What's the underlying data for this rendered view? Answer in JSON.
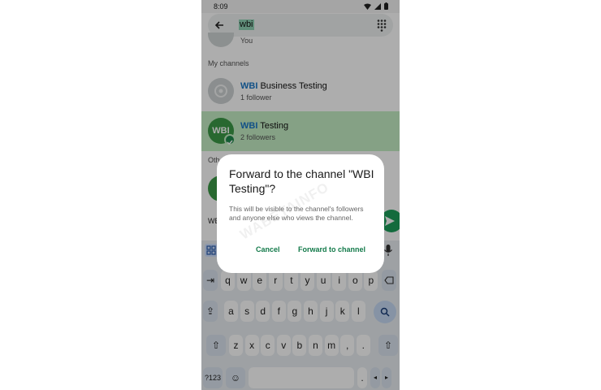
{
  "status_bar": {
    "time": "8:09"
  },
  "search": {
    "query": "wbi"
  },
  "partial_row": {
    "subtitle": "You"
  },
  "sections": {
    "my_channels": "My channels",
    "other": "Oth"
  },
  "channels": [
    {
      "highlight": "WBI",
      "name": " Business Testing",
      "subtitle": "1 follower"
    },
    {
      "highlight": "WBI",
      "name": " Testing",
      "subtitle": "2 followers",
      "avatar_text": "WBI"
    }
  ],
  "compose": {
    "text": "WB"
  },
  "keyboard": {
    "rows": [
      [
        "q",
        "w",
        "e",
        "r",
        "t",
        "y",
        "u",
        "i",
        "o",
        "p"
      ],
      [
        "a",
        "s",
        "d",
        "f",
        "g",
        "h",
        "j",
        "k",
        "l"
      ],
      [
        "z",
        "x",
        "c",
        "v",
        "b",
        "n",
        "m",
        ",",
        "."
      ]
    ],
    "symbols_label": "?123",
    "period": "."
  },
  "dialog": {
    "title": "Forward to the channel \"WBI Testing\"?",
    "body": "This will be visible to the channel's followers and anyone else who views the channel.",
    "cancel_label": "Cancel",
    "confirm_label": "Forward to channel",
    "watermark": "WABETAINFO"
  },
  "colors": {
    "accent": "#137a4a",
    "highlight_row": "#c4edc4",
    "highlight_text": "#1b78c8",
    "send": "#1d9e5a"
  }
}
